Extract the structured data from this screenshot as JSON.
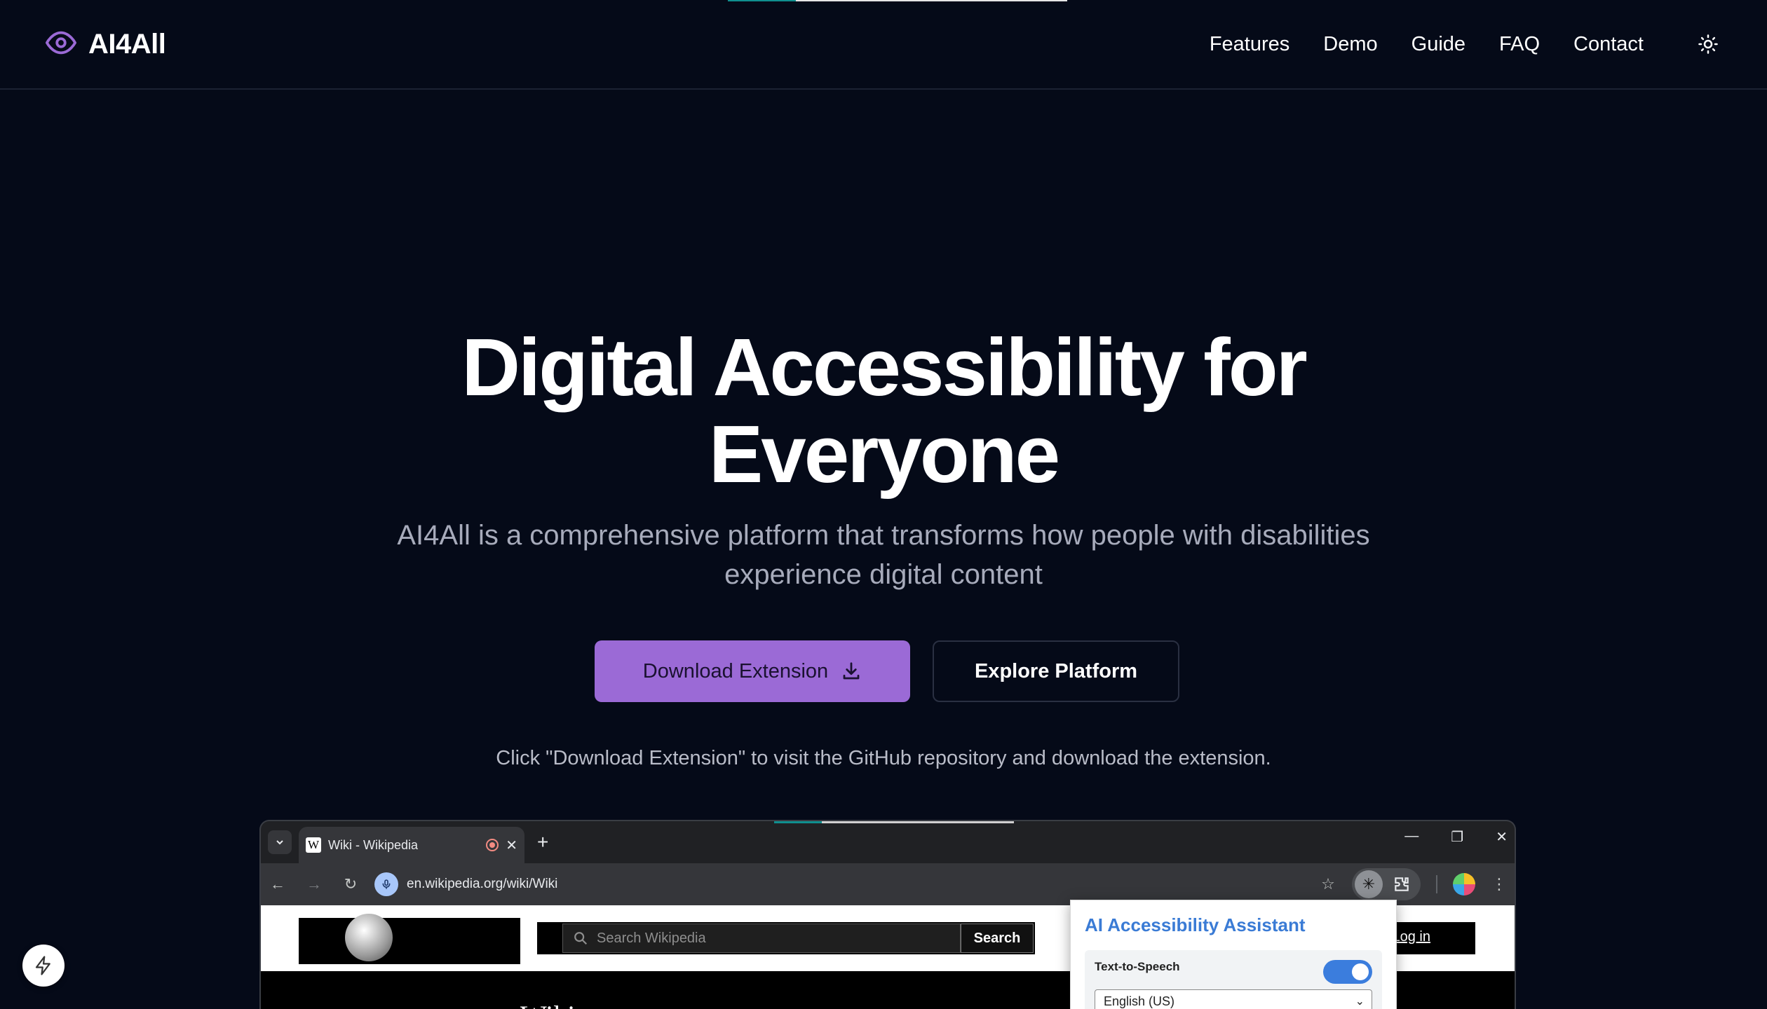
{
  "brand": {
    "name": "AI4All",
    "accent": "#9b6ad6"
  },
  "nav": {
    "items": [
      "Features",
      "Demo",
      "Guide",
      "FAQ",
      "Contact"
    ],
    "theme_icon": "sun-icon"
  },
  "hero": {
    "title_line1": "Digital Accessibility for",
    "title_line2": "Everyone",
    "subtitle": "AI4All is a comprehensive platform that transforms how people with disabilities experience digital content",
    "download_label": "Download Extension",
    "explore_label": "Explore Platform",
    "hint": "Click \"Download Extension\" to visit the GitHub repository and download the extension."
  },
  "mockup": {
    "tab_title": "Wiki - Wikipedia",
    "tab_favicon": "W",
    "url": "en.wikipedia.org/wiki/Wiki",
    "wiki": {
      "search_placeholder": "Search Wikipedia",
      "search_button": "Search",
      "login": "Log in",
      "heading": "Wiki"
    },
    "panel": {
      "title": "AI Accessibility Assistant",
      "tts_label": "Text-to-Speech",
      "tts_enabled": true,
      "language": "English (US)"
    }
  },
  "fab_icon": "bolt-icon"
}
